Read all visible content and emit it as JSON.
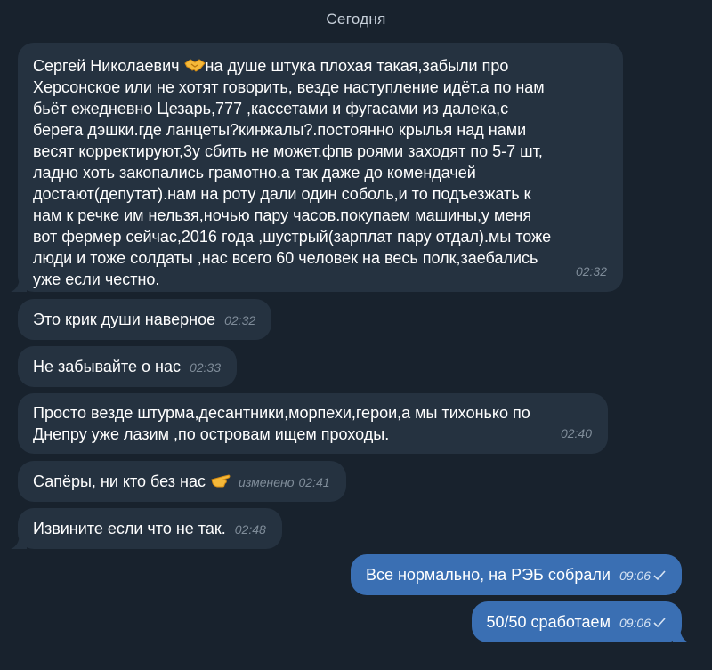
{
  "date_separator": "Сегодня",
  "messages": [
    {
      "text_before_emoji": "Сергей Николаевич ",
      "emoji": "handshake-emoji",
      "text_after_emoji": "на душе штука плохая такая,забыли про\nХерсонское или не хотят говорить, везде наступление идёт.а по нам\nбьёт ежедневно Цезарь,777 ,кассетами и фугасами из далека,с\nберега дэшки.где ланцеты?кинжалы?.постоянно крылья над нами\nвесят корректируют,3у сбить не может.фпв роями заходят по 5-7 шт,\nладно хоть закопались грамотно.а так даже до комендачей\nдостают(депутат).нам на роту дали один соболь,и то подъезжать к\nнам к речке им нельзя,ночью пару часов.покупаем машины,у меня\nвот фермер сейчас,2016 года ,шустрый(зарплат пару отдал).мы тоже\nлюди и тоже солдаты ,нас всего 60 человек на весь полк,заебались\nуже если честно.",
      "time": "02:32"
    },
    {
      "text": "Это крик души наверное",
      "time": "02:32"
    },
    {
      "text": "Не забывайте о нас",
      "time": "02:33"
    },
    {
      "text": "Просто везде штурма,десантники,морпехи,герои,а мы тихонько по\nДнепру уже лазим ,по островам ищем проходы.",
      "time": "02:40"
    },
    {
      "text": "Сапёры, ни кто без нас ",
      "emoji": "pointing-hand-emoji",
      "edited_label": "изменено",
      "time": "02:41"
    },
    {
      "text": "Извините если что не так.",
      "time": "02:48"
    },
    {
      "text": "Все нормально, на РЭБ собрали",
      "time": "09:06",
      "status": "sent-check"
    },
    {
      "text": "50/50 сработаем",
      "time": "09:06",
      "status": "sent-check"
    }
  ],
  "colors": {
    "background": "#18222d",
    "incoming_bubble": "#253240",
    "outgoing_bubble": "#3a6fb3",
    "meta_text": "#7f8c99"
  }
}
